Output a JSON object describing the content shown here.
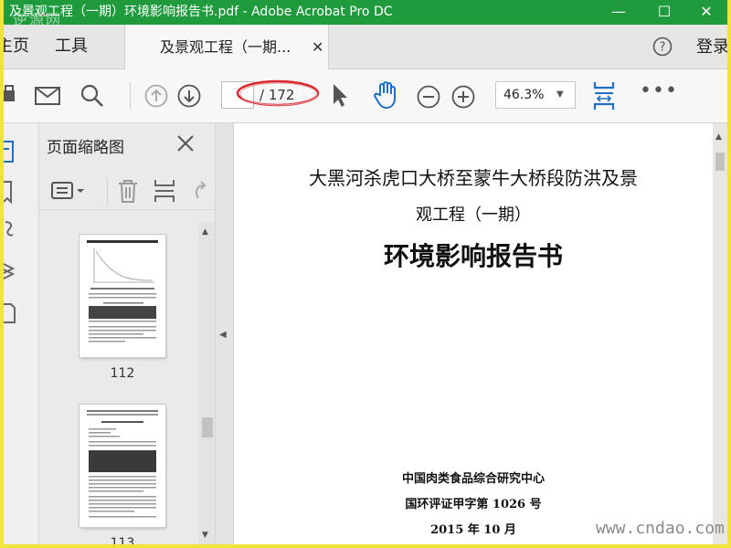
{
  "window": {
    "title": "及景观工程（一期）环境影响报告书.pdf - Adobe Acrobat Pro DC",
    "minimize": "—",
    "maximize": "☐",
    "close": "✕"
  },
  "menubar": {
    "home": "主页",
    "tools": "工具",
    "tab_label": "及景观工程（一期...",
    "tab_close": "✕",
    "login": "登录"
  },
  "toolbar": {
    "page_current": "",
    "page_total": "/ 172",
    "zoom": "46.3%",
    "more": "•••",
    "highlight_color": "#d9262c"
  },
  "panel": {
    "title": "页面缩略图",
    "thumbnails": [
      {
        "label": "112"
      },
      {
        "label": "113"
      }
    ]
  },
  "document": {
    "title_line1": "大黑河杀虎口大桥至蒙牛大桥段防洪及景",
    "title_line2": "观工程（一期）",
    "title_main": "环境影响报告书",
    "org": "中国肉类食品综合研究中心",
    "cert": "国环评证甲字第  1026  号",
    "date": "2015 年 10 月"
  },
  "watermarks": {
    "top_left": "逆源网",
    "bottom_right": "www.cndao.com"
  },
  "colors": {
    "titlebar": "#1f9b3e",
    "accent_blue": "#1f6fc5",
    "frame": "#f0e33a"
  }
}
